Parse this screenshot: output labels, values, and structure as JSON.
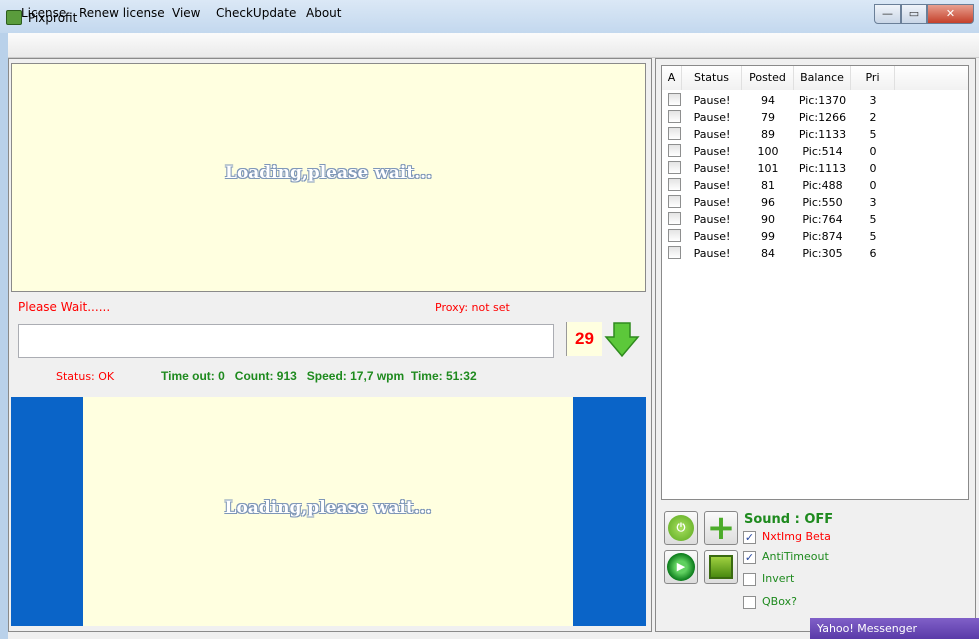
{
  "window": {
    "title": "Pixprofit",
    "min": "—",
    "max": "▭",
    "close": "✕"
  },
  "menu": [
    "License",
    "Renew license",
    "View",
    "CheckUpdate",
    "About"
  ],
  "loading_text": "Loading,please wait...",
  "please_wait": "Please Wait......",
  "proxy": "Proxy: not set",
  "captcha_input": "",
  "counter": "29",
  "status": "Status: OK",
  "stats": "Time out: 0   Count: 913   Speed: 17,7 wpm  Time: 51:32",
  "table": {
    "headers": [
      "A",
      "Status",
      "Posted",
      "Balance",
      "Pri"
    ],
    "rows": [
      [
        "Pause!",
        "94",
        "Pic:1370",
        "3"
      ],
      [
        "Pause!",
        "79",
        "Pic:1266",
        "2"
      ],
      [
        "Pause!",
        "89",
        "Pic:1133",
        "5"
      ],
      [
        "Pause!",
        "100",
        "Pic:514",
        "0"
      ],
      [
        "Pause!",
        "101",
        "Pic:1113",
        "0"
      ],
      [
        "Pause!",
        "81",
        "Pic:488",
        "0"
      ],
      [
        "Pause!",
        "96",
        "Pic:550",
        "3"
      ],
      [
        "Pause!",
        "90",
        "Pic:764",
        "5"
      ],
      [
        "Pause!",
        "99",
        "Pic:874",
        "5"
      ],
      [
        "Pause!",
        "84",
        "Pic:305",
        "6"
      ]
    ]
  },
  "sound": "Sound : OFF",
  "options": [
    {
      "label": "NxtImg Beta",
      "checked": true,
      "color": "#ff0000"
    },
    {
      "label": "AntiTimeout",
      "checked": true,
      "color": "#1e8a1e"
    },
    {
      "label": "Invert",
      "checked": false,
      "color": "#1e8a1e"
    },
    {
      "label": "QBox?",
      "checked": false,
      "color": "#1e8a1e"
    }
  ],
  "popup": "Yahoo! Messenger"
}
